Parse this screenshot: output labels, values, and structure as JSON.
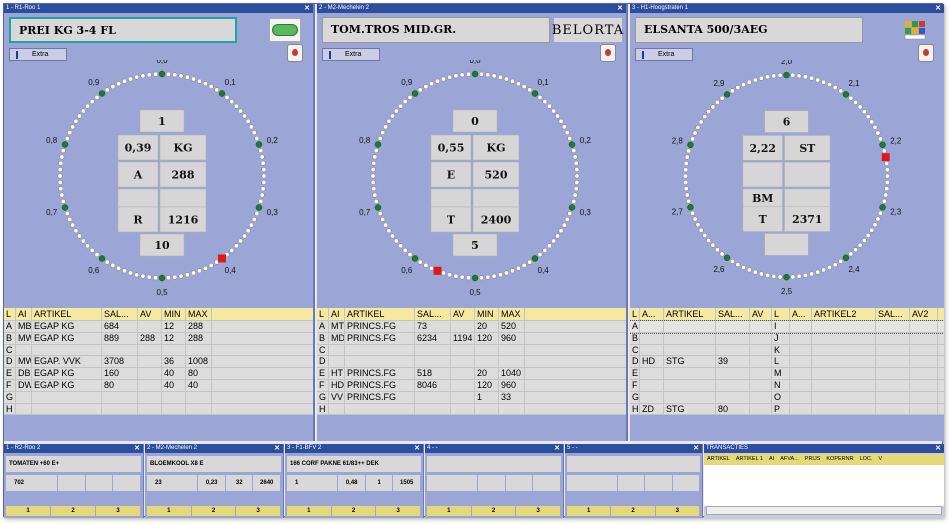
{
  "panels": [
    {
      "title": "1 - R1-Roo 1",
      "header": "PREI KG   3-4  FL",
      "extra_label": "Extra",
      "active_header": true,
      "labels": [
        "0,0",
        "0,1",
        "0,2",
        "0,3",
        "0,4",
        "0,5",
        "0,6",
        "0,7",
        "0,8",
        "0,9"
      ],
      "red_pos": 0.4,
      "boxes": {
        "top": "1",
        "r1a": "0,39",
        "r1b": "KG",
        "r2a": "A",
        "r2b": "288",
        "r3a": "",
        "r3b": "",
        "r4a": "R",
        "r4b": "1216",
        "bottom": "10"
      },
      "columns": [
        "L",
        "AI",
        "ARTIKEL",
        "SAL...",
        "AV",
        "MIN",
        "MAX"
      ],
      "rows": [
        [
          "A",
          "MB",
          "EGAP KG",
          "684",
          "",
          "12",
          "288"
        ],
        [
          "B",
          "MW",
          "EGAP KG",
          "889",
          "288",
          "12",
          "288"
        ],
        [
          "C",
          "",
          "",
          "",
          "",
          "",
          ""
        ],
        [
          "D",
          "MW",
          "EGAP. VVK",
          "3708",
          "",
          "36",
          "1008"
        ],
        [
          "E",
          "DB",
          "EGAP KG",
          "160",
          "",
          "40",
          "80"
        ],
        [
          "F",
          "DW",
          "EGAP KG",
          "80",
          "",
          "40",
          "40"
        ],
        [
          "G",
          "",
          "",
          "",
          "",
          "",
          ""
        ],
        [
          "H",
          "",
          "",
          "",
          "",
          "",
          ""
        ]
      ]
    },
    {
      "title": "2 - M2-Mechelen 2",
      "header": "TOM.TROS MID.GR.",
      "logo": "BELORTA",
      "extra_label": "Extra",
      "active_header": false,
      "labels": [
        "0,0",
        "0,1",
        "0,2",
        "0,3",
        "0,4",
        "0,5",
        "0,6",
        "0,7",
        "0,8",
        "0,9"
      ],
      "red_pos": 0.56,
      "boxes": {
        "top": "0",
        "r1a": "0,55",
        "r1b": "KG",
        "r2a": "E",
        "r2b": "520",
        "r3a": "",
        "r3b": "",
        "r4a": "T",
        "r4b": "2400",
        "bottom": "5"
      },
      "columns": [
        "L",
        "AI",
        "ARTIKEL",
        "SAL...",
        "AV",
        "MIN",
        "MAX"
      ],
      "rows": [
        [
          "A",
          "MT",
          "PRINCS.FG",
          "73",
          "",
          "20",
          "520"
        ],
        [
          "B",
          "MD",
          "PRINCS.FG",
          "6234",
          "1194",
          "120",
          "960"
        ],
        [
          "C",
          "",
          "",
          "",
          "",
          "",
          ""
        ],
        [
          "D",
          "",
          "",
          "",
          "",
          "",
          ""
        ],
        [
          "E",
          "HT",
          "PRINCS.FG",
          "518",
          "",
          "20",
          "1040"
        ],
        [
          "F",
          "HD",
          "PRINCS.FG",
          "8046",
          "",
          "120",
          "960"
        ],
        [
          "G",
          "VV",
          "PRINCS.FG",
          "",
          "",
          "1",
          "33"
        ],
        [
          "H",
          "",
          "",
          "",
          "",
          "",
          ""
        ]
      ]
    },
    {
      "title": "3 - H1-Hoogstraten 1",
      "header": "ELSANTA 500/3AEG",
      "extra_label": "Extra",
      "active_header": false,
      "labels": [
        "2,0",
        "2,1",
        "2,2",
        "2,3",
        "2,4",
        "2,5",
        "2,6",
        "2,7",
        "2,8",
        "2,9"
      ],
      "red_pos": 0.22,
      "boxes": {
        "top": "6",
        "r1a": "2,22",
        "r1b": "ST",
        "r2a": "",
        "r2b": "",
        "r3a": "BM",
        "r3b": "",
        "r4a": "T",
        "r4b": "2371",
        "bottom": ""
      },
      "columns": [
        "L",
        "A...",
        "ARTIKEL",
        "SAL...",
        "AV",
        "L",
        "A...",
        "ARTIKEL2",
        "SAL...",
        "AV2"
      ],
      "rows": [
        [
          "A",
          "",
          "",
          "",
          "",
          "I",
          "",
          "",
          "",
          ""
        ],
        [
          "B",
          "",
          "",
          "",
          "",
          "J",
          "",
          "",
          "",
          ""
        ],
        [
          "C",
          "",
          "",
          "",
          "",
          "K",
          "",
          "",
          "",
          ""
        ],
        [
          "D",
          "HD",
          "STG",
          "39",
          "",
          "L",
          "",
          "",
          "",
          ""
        ],
        [
          "E",
          "",
          "",
          "",
          "",
          "M",
          "",
          "",
          "",
          ""
        ],
        [
          "F",
          "",
          "",
          "",
          "",
          "N",
          "",
          "",
          "",
          ""
        ],
        [
          "G",
          "",
          "",
          "",
          "",
          "O",
          "",
          "",
          "",
          ""
        ],
        [
          "H",
          "ZD",
          "STG",
          "80",
          "",
          "P",
          "",
          "",
          "",
          ""
        ]
      ]
    }
  ],
  "minis": [
    {
      "title": "1 - R2-Roo 2",
      "header": "TOMATEN  +60  E+",
      "values": [
        "702",
        "",
        "",
        ""
      ],
      "nums": [
        "1",
        "2",
        "3"
      ]
    },
    {
      "title": "2 - M2-Mechelen 2",
      "header": "BLOEMKOOL X8 E",
      "values": [
        "23",
        "0,23",
        "32",
        "2640"
      ],
      "nums": [
        "1",
        "2",
        "3"
      ]
    },
    {
      "title": "3 - F1-BFV 2",
      "header": "166 CORF PAKNE 61/83++   DEK",
      "values": [
        "1",
        "0,48",
        "1",
        "1505"
      ],
      "nums": [
        "1",
        "2",
        "3"
      ]
    },
    {
      "title": "4 - -",
      "header": "",
      "values": [
        "",
        "",
        "",
        ""
      ],
      "nums": [
        "1",
        "2",
        "3"
      ]
    },
    {
      "title": "5 - -",
      "header": "",
      "values": [
        "",
        "",
        "",
        ""
      ],
      "nums": [
        "1",
        "2",
        "3"
      ]
    }
  ],
  "transacties": {
    "title": "TRANSACTIES",
    "columns": [
      "ARTIKEL",
      "ARTIKEL 1",
      "AI",
      "AFVA...",
      "PRIJS",
      "KOPERNR",
      "LOC.",
      "V"
    ]
  }
}
